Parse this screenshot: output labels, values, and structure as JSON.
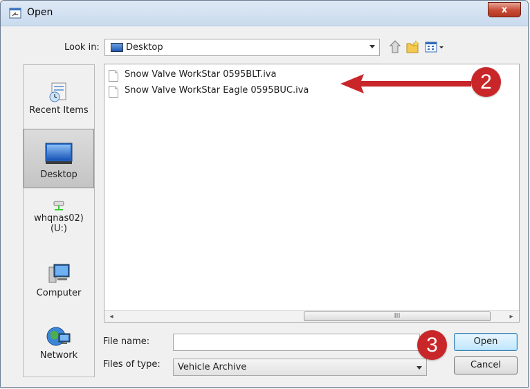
{
  "window": {
    "title": "Open",
    "close_glyph": "x"
  },
  "toolbar": {
    "look_in_label": "Look in:",
    "look_in_value": "Desktop",
    "icons": [
      "up-folder-icon",
      "new-folder-icon",
      "view-menu-icon"
    ]
  },
  "places": [
    {
      "label": "Recent Items",
      "icon": "recent-items-icon",
      "selected": false
    },
    {
      "label": "Desktop",
      "icon": "desktop-icon",
      "selected": true
    },
    {
      "label_line1": "whqnas02)",
      "label_line2": "(U:)",
      "icon": "network-drive-icon",
      "selected": false
    },
    {
      "label": "Computer",
      "icon": "computer-icon",
      "selected": false
    },
    {
      "label": "Network",
      "icon": "network-icon",
      "selected": false
    }
  ],
  "files": [
    {
      "name": "Snow Valve WorkStar 0595BLT.iva"
    },
    {
      "name": "Snow Valve WorkStar Eagle 0595BUC.iva"
    }
  ],
  "scrollbar": {
    "left_arrow": "◂",
    "right_arrow": "▸",
    "thumb_grip": "III"
  },
  "form": {
    "file_name_label": "File name:",
    "file_name_value": "",
    "files_of_type_label": "Files of type:",
    "files_of_type_value": "Vehicle Archive"
  },
  "buttons": {
    "open": "Open",
    "cancel": "Cancel"
  },
  "annotations": {
    "step2": "2",
    "step3": "3",
    "badge_color": "#c9262a"
  }
}
